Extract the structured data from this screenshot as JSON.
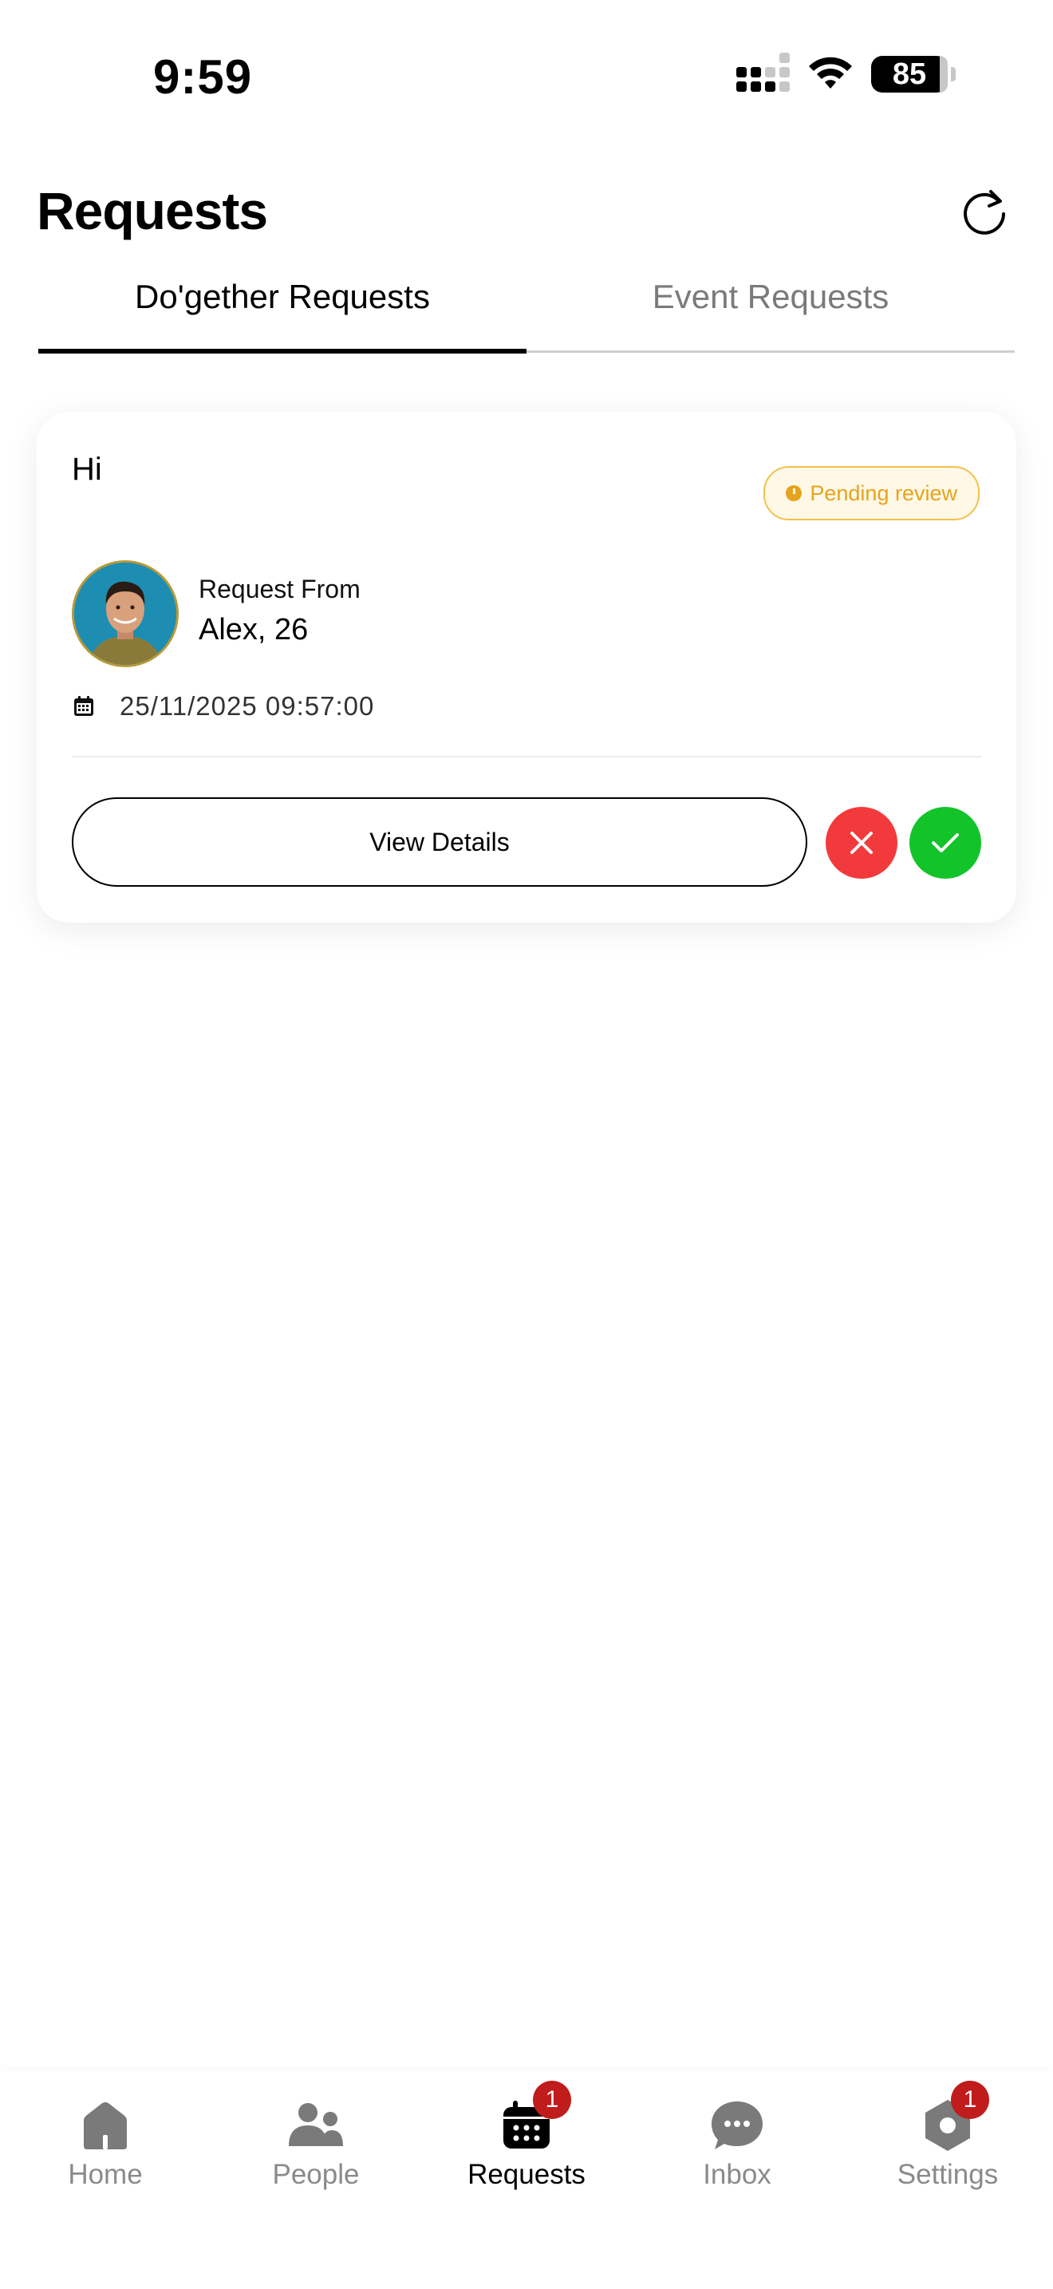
{
  "status_bar": {
    "time": "9:59",
    "battery": "85"
  },
  "header": {
    "title": "Requests"
  },
  "tabs": [
    {
      "label": "Do'gether Requests",
      "active": true
    },
    {
      "label": "Event Requests",
      "active": false
    }
  ],
  "request_card": {
    "title": "Hi",
    "status": "Pending review",
    "from_label": "Request From",
    "from_name": "Alex, 26",
    "datetime": "25/11/2025 09:57:00",
    "view_details_label": "View Details"
  },
  "bottom_nav": [
    {
      "label": "Home",
      "icon": "home-icon",
      "badge": null
    },
    {
      "label": "People",
      "icon": "people-icon",
      "badge": null
    },
    {
      "label": "Requests",
      "icon": "calendar-icon",
      "badge": "1",
      "active": true
    },
    {
      "label": "Inbox",
      "icon": "chat-icon",
      "badge": null
    },
    {
      "label": "Settings",
      "icon": "settings-icon",
      "badge": "1"
    }
  ],
  "colors": {
    "pending": "#e7a31d",
    "reject": "#f23a3c",
    "accept": "#12c42a",
    "badge": "#c01c1c"
  }
}
